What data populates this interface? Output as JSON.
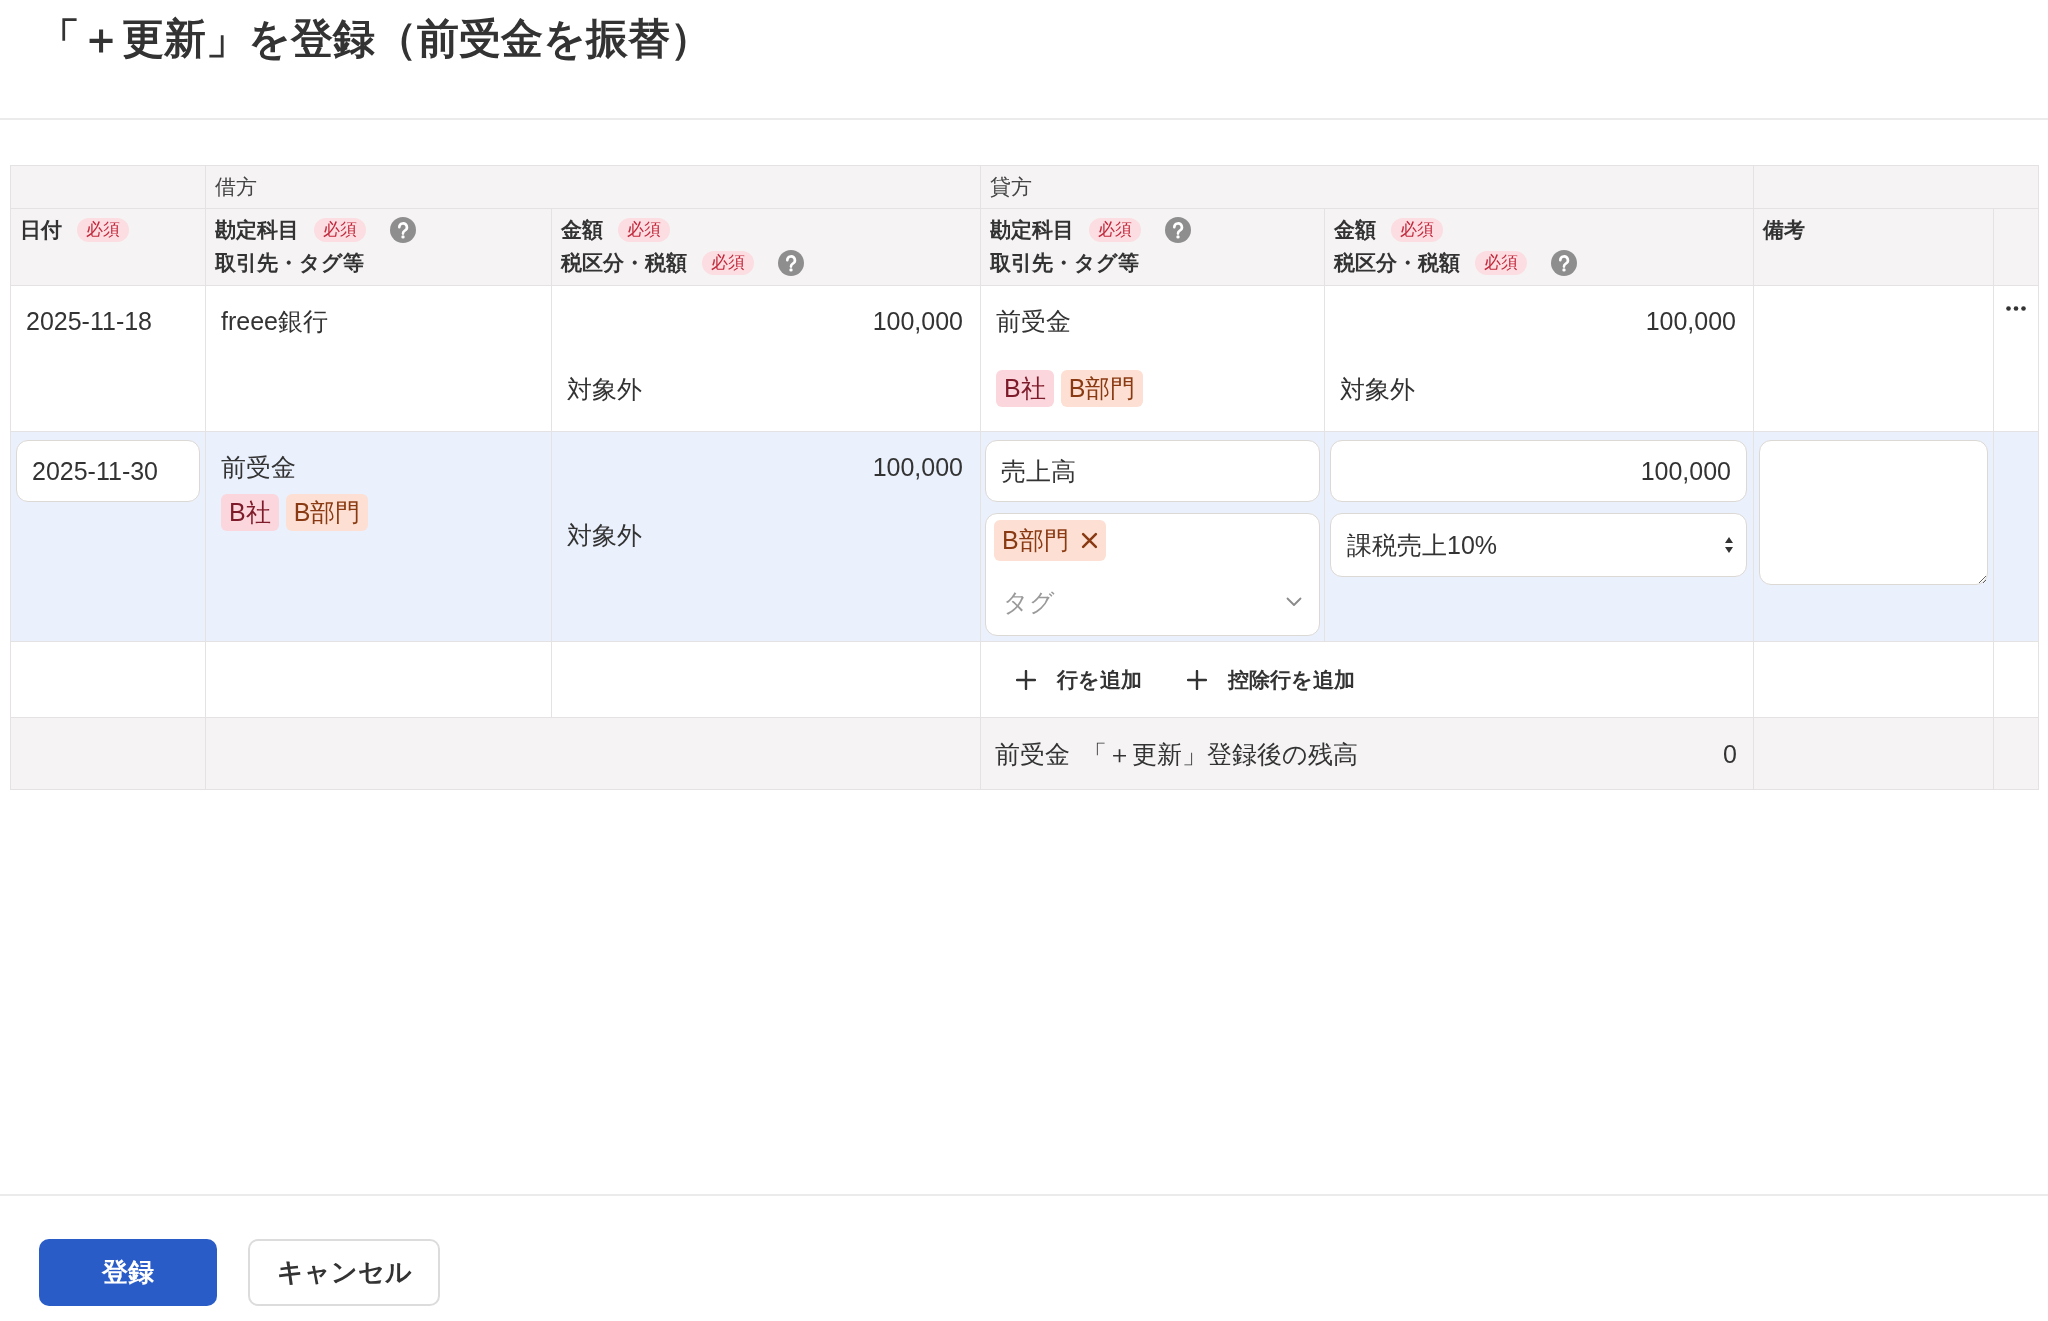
{
  "title": "「＋更新」を登録（前受金を振替）",
  "journal_table": {
    "group_headers": {
      "debit": "借方",
      "credit": "貸方"
    },
    "columns": [
      {
        "lines": [
          {
            "label": "日付",
            "badge": "必須",
            "help": false
          }
        ]
      },
      {
        "lines": [
          {
            "label": "勘定科目",
            "badge": "必須",
            "help": true
          },
          {
            "label": "取引先・タグ等",
            "help": false
          }
        ]
      },
      {
        "lines": [
          {
            "label": "金額",
            "badge": "必須",
            "help": false
          },
          {
            "label": "税区分・税額",
            "badge": "必須",
            "help": true
          }
        ]
      },
      {
        "lines": [
          {
            "label": "勘定科目",
            "badge": "必須",
            "help": true
          },
          {
            "label": "取引先・タグ等",
            "help": false
          }
        ]
      },
      {
        "lines": [
          {
            "label": "金額",
            "badge": "必須",
            "help": false
          },
          {
            "label": "税区分・税額",
            "badge": "必須",
            "help": true
          }
        ]
      },
      {
        "lines": [
          {
            "label": "備考",
            "help": false
          }
        ]
      }
    ],
    "rows": [
      {
        "active": false,
        "menu": true,
        "date": {
          "value": "2025-11-18",
          "editable": false
        },
        "debit": {
          "editable": false,
          "account": "freee銀行",
          "amount": "100,000",
          "tax": "対象外"
        },
        "credit": {
          "editable": false,
          "account": "前受金",
          "tags": [
            {
              "label": "B社",
              "kind": "partner",
              "removable": false
            },
            {
              "label": "B部門",
              "kind": "section",
              "removable": false
            }
          ],
          "amount": "100,000",
          "tax": "対象外"
        },
        "note": {
          "editable": false
        }
      },
      {
        "active": true,
        "menu": false,
        "date": {
          "value": "2025-11-30",
          "editable": true
        },
        "debit": {
          "editable": false,
          "account": "前受金",
          "tags": [
            {
              "label": "B社",
              "kind": "partner",
              "removable": false
            },
            {
              "label": "B部門",
              "kind": "section",
              "removable": false
            }
          ],
          "amount": "100,000",
          "tax": "対象外"
        },
        "credit": {
          "editable": true,
          "account": "売上高",
          "tags": [
            {
              "label": "B部門",
              "kind": "section",
              "removable": true
            }
          ],
          "tag_placeholder": "タグ",
          "amount": "100,000",
          "tax": "課税売上10%"
        },
        "note": {
          "editable": true
        }
      }
    ],
    "add_actions": [
      {
        "label": "行を追加"
      },
      {
        "label": "控除行を追加"
      }
    ],
    "balance": {
      "account": "前受金",
      "label": "「＋更新」登録後の残高",
      "value": "0"
    }
  },
  "footer_buttons": [
    {
      "label": "登録",
      "kind": "primary"
    },
    {
      "label": "キャンセル",
      "kind": "secondary"
    }
  ]
}
